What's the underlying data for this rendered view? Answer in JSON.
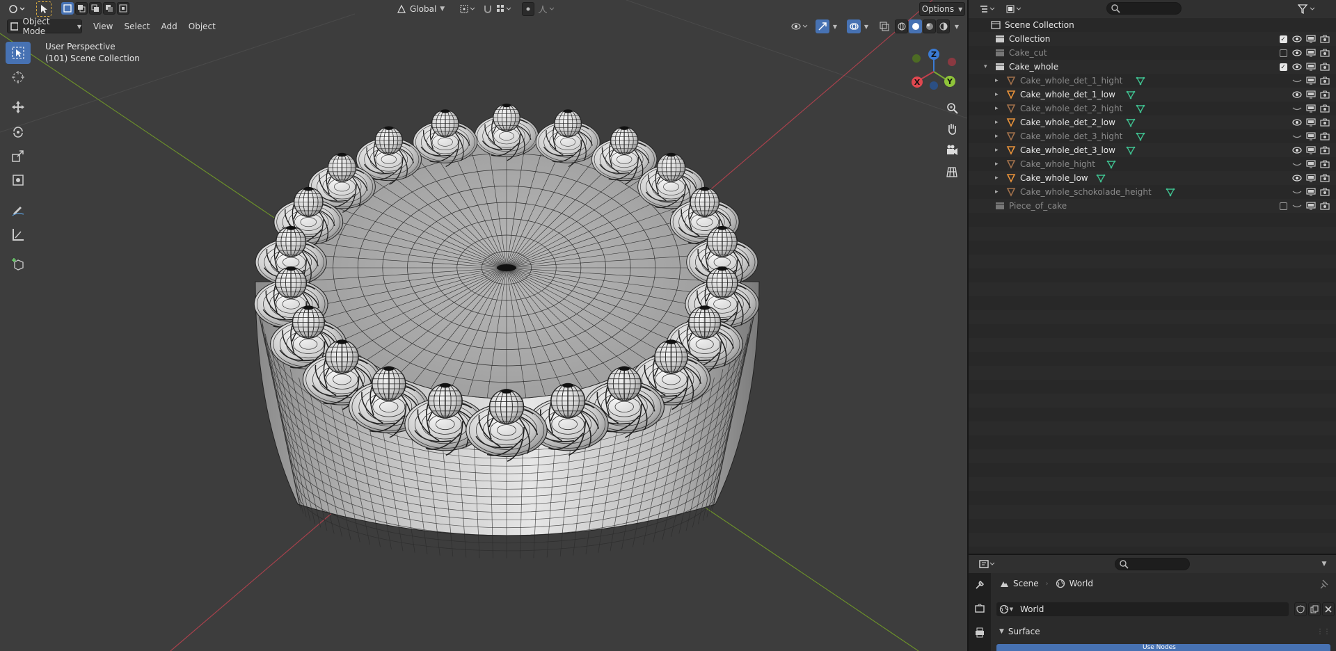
{
  "viewport": {
    "header": {
      "transform_orientation": "Global",
      "options_label": "Options"
    },
    "header2": {
      "mode": "Object Mode",
      "menus": [
        "View",
        "Select",
        "Add",
        "Object"
      ]
    },
    "overlay_text": {
      "perspective": "User Perspective",
      "collection": "(101) Scene Collection"
    },
    "gizmo": {
      "x": "X",
      "y": "Y",
      "z": "Z"
    },
    "colors": {
      "background": "#3d3d3d",
      "x_axis": "#c0404c",
      "y_axis": "#7aa832",
      "z_axis": "#3b7bd4",
      "active": "#4772b3"
    }
  },
  "outliner": {
    "rows": [
      {
        "label": "Scene Collection",
        "type": "scene",
        "depth": 0,
        "dim": false,
        "expander": "",
        "checkbox": null,
        "visible": null,
        "mesh_data": false
      },
      {
        "label": "Collection",
        "type": "collection",
        "depth": 1,
        "dim": false,
        "expander": "",
        "checkbox": true,
        "visible": true,
        "mesh_data": false
      },
      {
        "label": "Cake_cut",
        "type": "collection",
        "depth": 1,
        "dim": true,
        "expander": "",
        "checkbox": false,
        "visible": true,
        "mesh_data": false
      },
      {
        "label": "Cake_whole",
        "type": "collection",
        "depth": 1,
        "dim": false,
        "expander": "▾",
        "checkbox": true,
        "visible": true,
        "mesh_data": false
      },
      {
        "label": "Cake_whole_det_1_hight",
        "type": "mesh",
        "depth": 2,
        "dim": true,
        "expander": "▸",
        "checkbox": null,
        "visible": false,
        "mesh_data": true
      },
      {
        "label": "Cake_whole_det_1_low",
        "type": "mesh",
        "depth": 2,
        "dim": false,
        "expander": "▸",
        "checkbox": null,
        "visible": true,
        "mesh_data": true
      },
      {
        "label": "Cake_whole_det_2_hight",
        "type": "mesh",
        "depth": 2,
        "dim": true,
        "expander": "▸",
        "checkbox": null,
        "visible": false,
        "mesh_data": true
      },
      {
        "label": "Cake_whole_det_2_low",
        "type": "mesh",
        "depth": 2,
        "dim": false,
        "expander": "▸",
        "checkbox": null,
        "visible": true,
        "mesh_data": true
      },
      {
        "label": "Cake_whole_det_3_hight",
        "type": "mesh",
        "depth": 2,
        "dim": true,
        "expander": "▸",
        "checkbox": null,
        "visible": false,
        "mesh_data": true
      },
      {
        "label": "Cake_whole_det_3_low",
        "type": "mesh",
        "depth": 2,
        "dim": false,
        "expander": "▸",
        "checkbox": null,
        "visible": true,
        "mesh_data": true
      },
      {
        "label": "Cake_whole_hight",
        "type": "mesh",
        "depth": 2,
        "dim": true,
        "expander": "▸",
        "checkbox": null,
        "visible": false,
        "mesh_data": true
      },
      {
        "label": "Cake_whole_low",
        "type": "mesh",
        "depth": 2,
        "dim": false,
        "expander": "▸",
        "checkbox": null,
        "visible": true,
        "mesh_data": true
      },
      {
        "label": "Cake_whole_schokolade_height",
        "type": "mesh",
        "depth": 2,
        "dim": true,
        "expander": "▸",
        "checkbox": null,
        "visible": false,
        "mesh_data": true
      },
      {
        "label": "Piece_of_cake",
        "type": "collection",
        "depth": 1,
        "dim": true,
        "expander": "",
        "checkbox": false,
        "visible": false,
        "mesh_data": false
      }
    ],
    "mesh_icon_color": "#e8923a",
    "mesh_data_color": "#3fbf8f"
  },
  "properties": {
    "breadcrumb": {
      "scene": "Scene",
      "world": "World"
    },
    "world_field": "World",
    "panel_title": "Surface",
    "node_label": "Use Nodes"
  }
}
